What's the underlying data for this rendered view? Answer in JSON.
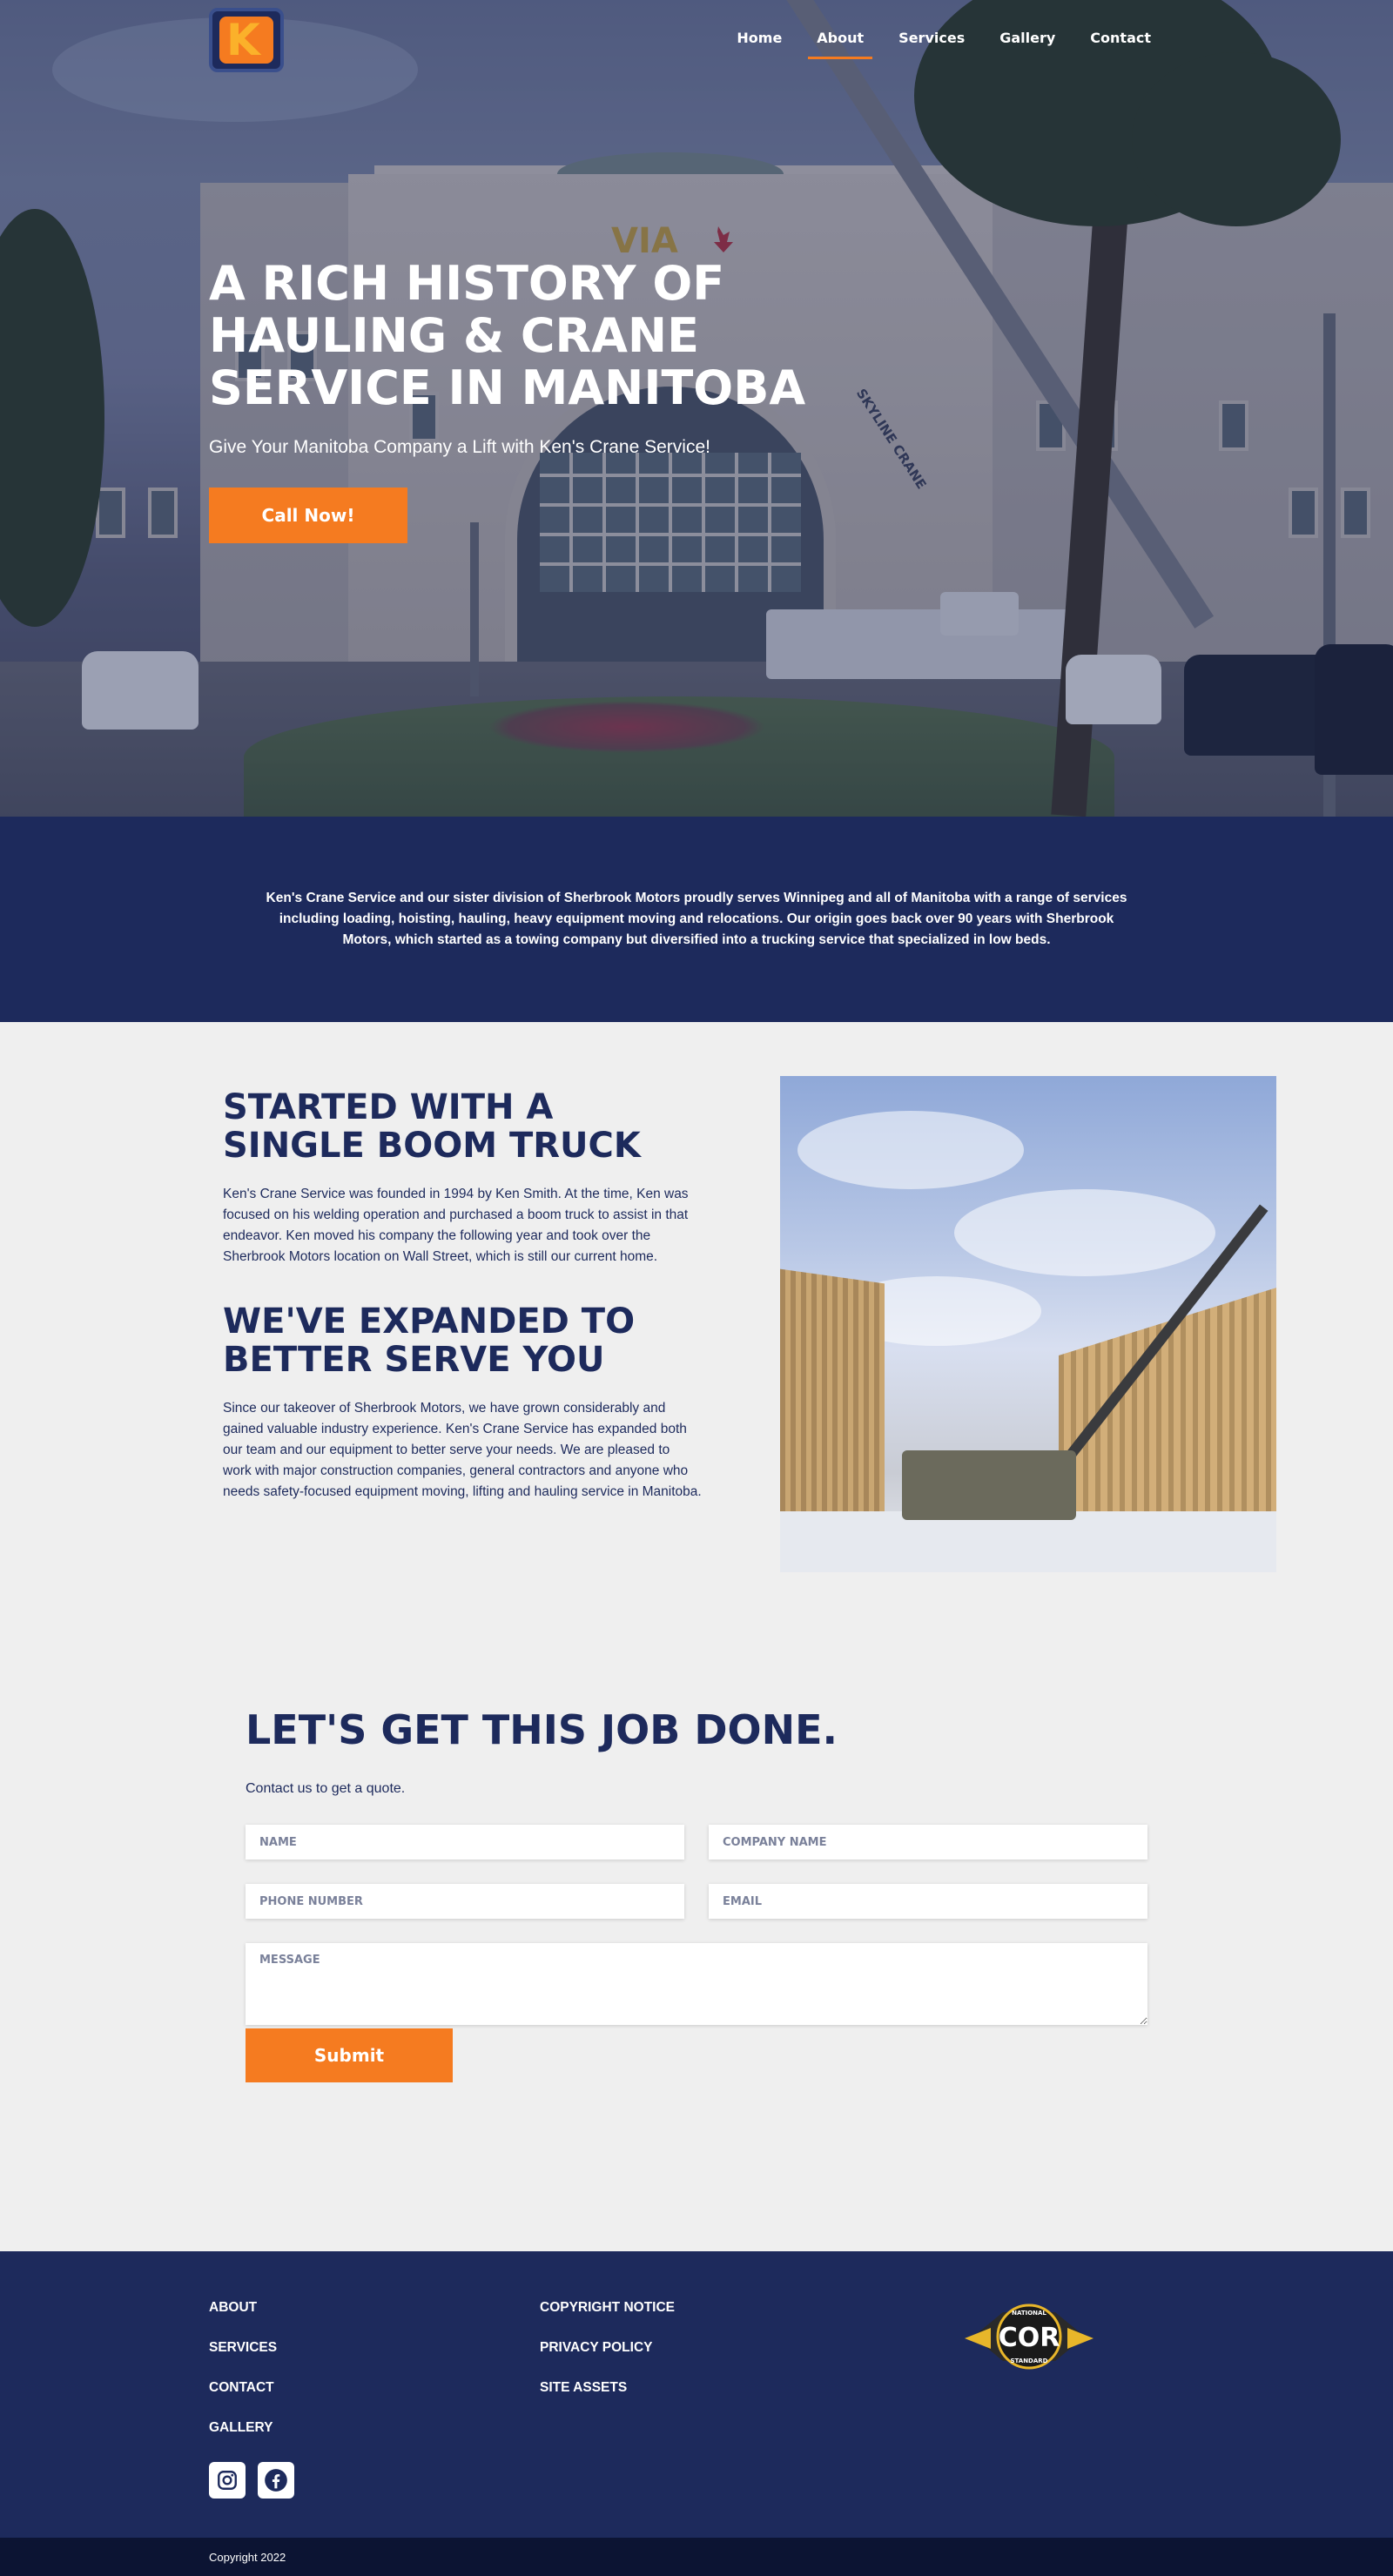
{
  "nav": {
    "logo_letter": "K",
    "links": [
      {
        "label": "Home"
      },
      {
        "label": "About",
        "active": true
      },
      {
        "label": "Services"
      },
      {
        "label": "Gallery"
      },
      {
        "label": "Contact"
      }
    ]
  },
  "hero": {
    "title": "A RICH HISTORY OF HAULING & CRANE SERVICE IN MANITOBA",
    "subtitle": "Give Your Manitoba Company a Lift with Ken's Crane Service!",
    "cta_label": "Call Now!",
    "sign_text": "VIA",
    "crane_text": "SKYLINE CRANE"
  },
  "intro": {
    "text": "Ken's Crane Service and our sister division of Sherbrook Motors proudly serves Winnipeg and all of Manitoba with a range of services including loading, hoisting, hauling, heavy equipment moving and relocations. Our origin goes back over 90 years with Sherbrook Motors, which started as a towing company but diversified into a trucking service that specialized in low beds."
  },
  "history": {
    "heading1": "STARTED WITH A SINGLE BOOM TRUCK",
    "para1": "Ken's Crane Service was founded in 1994 by Ken Smith. At the time, Ken was focused on his welding operation and purchased a boom truck to assist in that endeavor. Ken moved his company the following year and took over the Sherbrook Motors location on Wall Street, which is still our current home.",
    "heading2": "WE'VE EXPANDED TO BETTER SERVE YOU",
    "para2": "Since our takeover of Sherbrook Motors, we have grown considerably and gained valuable industry experience. Ken's Crane Service has expanded both our team and our equipment to better serve your needs. We are pleased to work with major construction companies, general contractors and anyone who needs safety-focused equipment moving, lifting and hauling service in Manitoba."
  },
  "contact": {
    "title": "LET'S GET THIS JOB DONE.",
    "subtitle": "Contact us to get a quote.",
    "fields": {
      "name_placeholder": "NAME",
      "company_placeholder": "COMPANY NAME",
      "phone_placeholder": "PHONE NUMBER",
      "email_placeholder": "EMAIL",
      "message_placeholder": "MESSAGE"
    },
    "submit_label": "Submit"
  },
  "footer": {
    "col1": [
      "ABOUT",
      "SERVICES",
      "CONTACT",
      "GALLERY"
    ],
    "col2": [
      "COPYRIGHT NOTICE",
      "PRIVACY POLICY",
      "SITE ASSETS"
    ],
    "badge": {
      "top": "NATIONAL",
      "main": "COR",
      "bottom": "STANDARD"
    },
    "social": [
      "instagram-icon",
      "facebook-icon"
    ],
    "copyright": "Copyright 2022"
  },
  "colors": {
    "navy": "#1d2a5c",
    "orange": "#f57b20",
    "background": "#efefef",
    "footer_bottom": "#0c1433"
  }
}
